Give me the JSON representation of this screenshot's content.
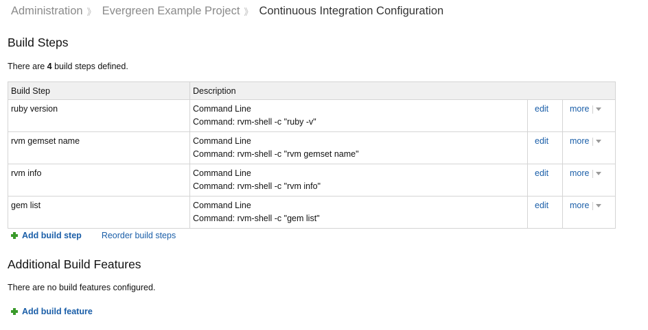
{
  "breadcrumb": {
    "items": [
      "Administration",
      "Evergreen Example Project"
    ],
    "current": "Continuous Integration Configuration"
  },
  "build_steps": {
    "heading": "Build Steps",
    "summary_prefix": "There are ",
    "count": "4",
    "summary_suffix": " build steps defined.",
    "columns": [
      "Build Step",
      "Description"
    ],
    "rows": [
      {
        "name": "ruby version",
        "type": "Command Line",
        "command": "Command: rvm-shell -c \"ruby -v\"",
        "edit": "edit",
        "more": "more"
      },
      {
        "name": "rvm gemset name",
        "type": "Command Line",
        "command": "Command: rvm-shell -c \"rvm gemset name\"",
        "edit": "edit",
        "more": "more"
      },
      {
        "name": "rvm info",
        "type": "Command Line",
        "command": "Command: rvm-shell -c \"rvm info\"",
        "edit": "edit",
        "more": "more"
      },
      {
        "name": "gem list",
        "type": "Command Line",
        "command": "Command: rvm-shell -c \"gem list\"",
        "edit": "edit",
        "more": "more"
      }
    ],
    "add_label": "Add build step",
    "reorder_label": "Reorder build steps"
  },
  "build_features": {
    "heading": "Additional Build Features",
    "empty_text": "There are no build features configured.",
    "add_label": "Add build feature"
  },
  "icons": {
    "breadcrumb_separator": "chevron-right-icon",
    "add": "plus-icon",
    "more_dropdown": "caret-down-icon"
  },
  "colors": {
    "link": "#1a5ea8",
    "add_icon": "#3a9a2a",
    "table_header_bg": "#f0f0f0",
    "table_border": "#d4d4d4"
  }
}
